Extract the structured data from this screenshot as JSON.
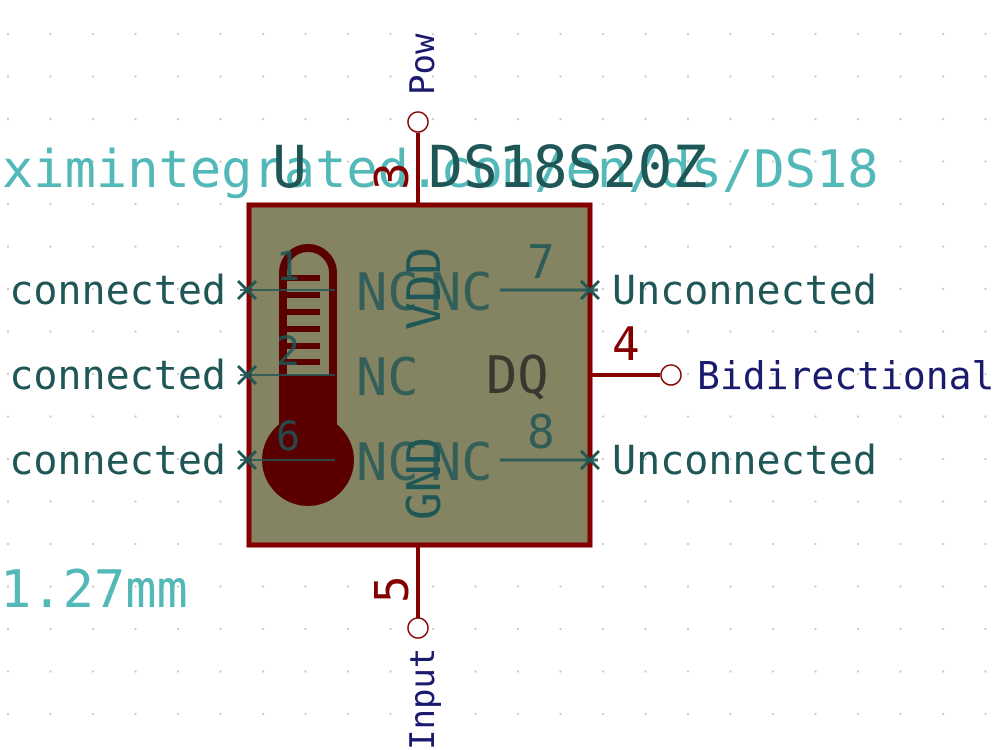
{
  "component": {
    "reference": "U",
    "value": "DS18S20Z",
    "datasheet_url": "ximintegrated.com/en/ds/DS18",
    "footprint_note": "1.27mm"
  },
  "pins_left": [
    {
      "number": "1",
      "name": "NC",
      "net_label": "connected"
    },
    {
      "number": "2",
      "name": "NC",
      "net_label": "connected"
    },
    {
      "number": "6",
      "name": "NC",
      "net_label": "connected"
    }
  ],
  "pins_right": [
    {
      "number": "7",
      "name": "NC",
      "net_label": "Unconnected"
    },
    {
      "number": "8",
      "name": "NC",
      "net_label": "Unconnected"
    }
  ],
  "pin_dq": {
    "number": "4",
    "name": "DQ",
    "net_label": "Bidirectional"
  },
  "pin_vdd": {
    "number": "3",
    "name": "VDD",
    "net_label": "Pow"
  },
  "pin_gnd": {
    "number": "5",
    "name": "GND",
    "net_label": "Input"
  },
  "colors": {
    "body_fill": "#848462",
    "outline": "#840000",
    "pin_text": "#1f5656",
    "net_label": "#1a1a6e",
    "field_text": "#52b8b8",
    "grid_dot": "#c8c8c8"
  }
}
